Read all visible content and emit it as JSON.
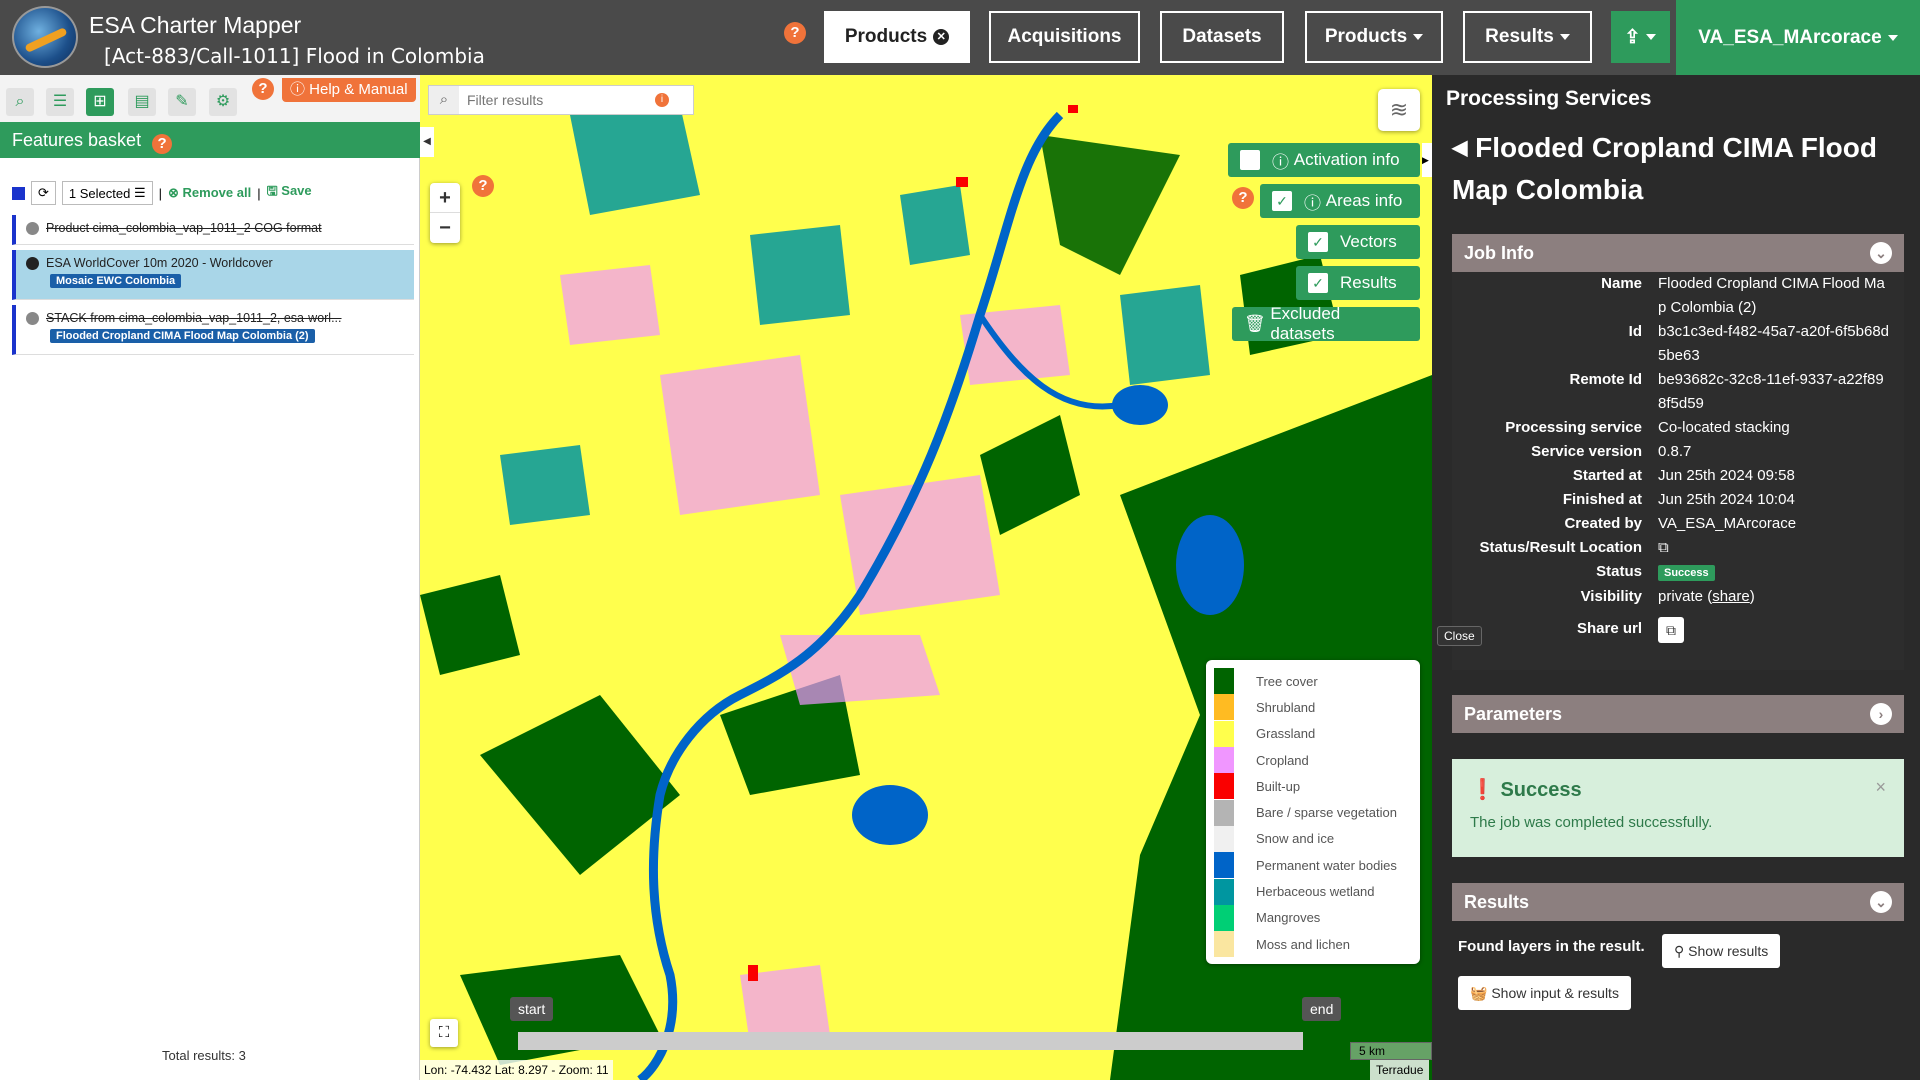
{
  "header": {
    "app_title": "ESA Charter Mapper",
    "activation_title": "[Act-883/Call-1011] Flood in Colombia",
    "nav": [
      {
        "label": "Products",
        "active": true,
        "icon": "close-circle-icon"
      },
      {
        "label": "Acquisitions"
      },
      {
        "label": "Datasets"
      },
      {
        "label": "Products",
        "dropdown": true
      },
      {
        "label": "Results",
        "dropdown": true
      }
    ],
    "upload_icon": "upload-icon",
    "user": "VA_ESA_MArcorace"
  },
  "left": {
    "help_manual": "Help & Manual",
    "basket_title": "Features basket",
    "selected_label": "1 Selected",
    "remove_all": "Remove all",
    "save": "Save",
    "items": [
      {
        "title": "Product cima_colombia_vap_1011_2 COG format",
        "tag": "",
        "struck": true
      },
      {
        "title": "ESA WorldCover 10m 2020 - Worldcover",
        "tag": "Mosaic EWC Colombia",
        "selected": true
      },
      {
        "title": "STACK from cima_colombia_vap_1011_2, esa-worl...",
        "tag": "Flooded Cropland CIMA Flood Map Colombia (2)",
        "struck": true
      }
    ],
    "total_results": "Total results: 3"
  },
  "map": {
    "filter_placeholder": "Filter results",
    "buttons": {
      "activation_info": "Activation info",
      "areas_info": "Areas info",
      "vectors": "Vectors",
      "results": "Results",
      "excluded": "Excluded datasets"
    },
    "legend": [
      {
        "label": "Tree cover",
        "color": "#006400"
      },
      {
        "label": "Shrubland",
        "color": "#ffbb22"
      },
      {
        "label": "Grassland",
        "color": "#ffff4c"
      },
      {
        "label": "Cropland",
        "color": "#f096ff"
      },
      {
        "label": "Built-up",
        "color": "#fa0000"
      },
      {
        "label": "Bare / sparse vegetation",
        "color": "#b4b4b4"
      },
      {
        "label": "Snow and ice",
        "color": "#f0f0f0"
      },
      {
        "label": "Permanent water bodies",
        "color": "#0064c8"
      },
      {
        "label": "Herbaceous wetland",
        "color": "#0096a0"
      },
      {
        "label": "Mangroves",
        "color": "#00cf75"
      },
      {
        "label": "Moss and lichen",
        "color": "#fae6a0"
      }
    ],
    "time_start": "start",
    "time_end": "end",
    "scale": "5 km",
    "coords": "Lon: -74.432 Lat: 8.297 - Zoom: 11",
    "attribution": "Terradue"
  },
  "right": {
    "panel_title": "Processing Services",
    "service_title": "Flooded Cropland CIMA Flood Map Colombia",
    "job_info_title": "Job Info",
    "job": [
      {
        "k": "Name",
        "v": "Flooded Cropland CIMA Flood Map Colombia (2)"
      },
      {
        "k": "Id",
        "v": "b3c1c3ed-f482-45a7-a20f-6f5b68d5be63"
      },
      {
        "k": "Remote Id",
        "v": "be93682c-32c8-11ef-9337-a22f898f5d59"
      },
      {
        "k": "Processing service",
        "v": "Co-located stacking"
      },
      {
        "k": "Service version",
        "v": "0.8.7"
      },
      {
        "k": "Started at",
        "v": "Jun 25th 2024 09:58"
      },
      {
        "k": "Finished at",
        "v": "Jun 25th 2024 10:04"
      },
      {
        "k": "Created by",
        "v": "VA_ESA_MArcorace"
      }
    ],
    "status_location_label": "Status/Result Location",
    "status_label": "Status",
    "status_value": "Success",
    "visibility_label": "Visibility",
    "visibility_value": "private",
    "visibility_share": "share",
    "share_url_label": "Share url",
    "close_tooltip": "Close",
    "parameters_title": "Parameters",
    "success_title": "Success",
    "success_msg": "The job was completed successfully.",
    "results_title": "Results",
    "found_layers": "Found layers in the result.",
    "show_results": "Show results",
    "show_input_results": "Show input & results"
  }
}
